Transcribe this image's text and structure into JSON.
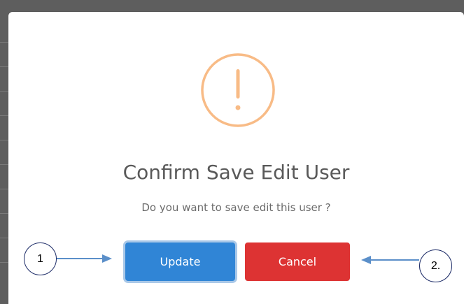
{
  "dialog": {
    "icon": "warning-exclamation-icon",
    "icon_color": "#f8bb86",
    "title": "Confirm Save Edit User",
    "message": "Do you want to save edit this user ?",
    "buttons": {
      "update_label": "Update",
      "update_color": "#3085d6",
      "cancel_label": "Cancel",
      "cancel_color": "#dd3333"
    }
  },
  "annotations": {
    "callout_1": "1",
    "callout_2": "2.",
    "arrow_color": "#5b8fc9"
  }
}
